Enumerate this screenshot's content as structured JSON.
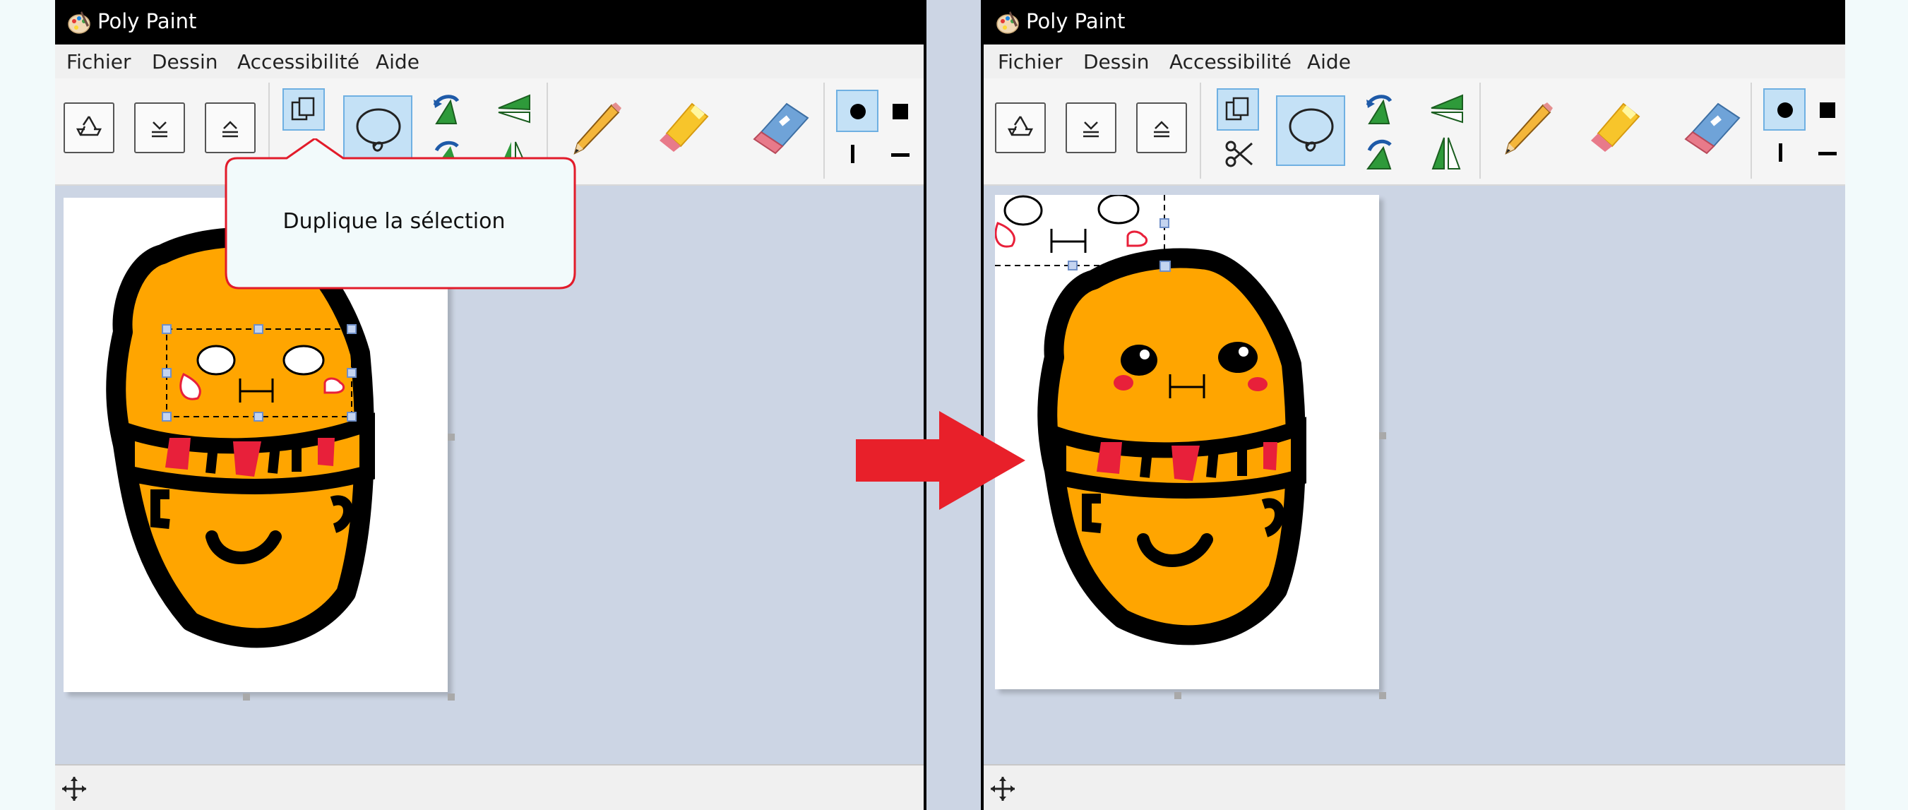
{
  "left_window": {
    "title": "Poly Paint",
    "menu": [
      "Fichier",
      "Dessin",
      "Accessibilité",
      "Aide"
    ],
    "tooltip": "Duplique la sélection"
  },
  "right_window": {
    "title": "Poly Paint",
    "menu": [
      "Fichier",
      "Dessin",
      "Accessibilité",
      "Aide"
    ]
  },
  "icons": {
    "app": "palette-icon",
    "tools": [
      "recycle-icon",
      "move-down-icon",
      "move-up-icon",
      "duplicate-icon",
      "cut-icon",
      "lasso-icon",
      "rotate-left-icon",
      "flip-icon",
      "pencil-icon",
      "highlighter-icon",
      "eraser-icon",
      "round-tip-icon",
      "square-tip-icon",
      "vertical-tip-icon",
      "horizontal-tip-icon"
    ],
    "status": "move-cross-icon"
  },
  "colors": {
    "accent_highlight": "#c4e1f6",
    "character_fill": "#ffa500",
    "outline": "#000000",
    "blush": "#e8203a",
    "arrow": "#e8202a"
  }
}
